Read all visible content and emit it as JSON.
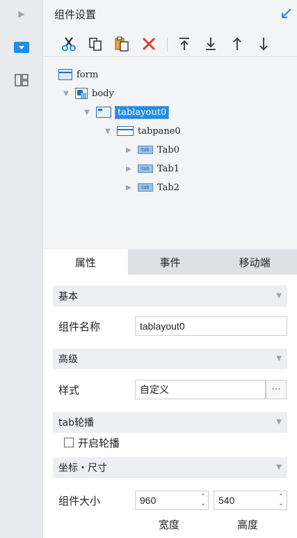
{
  "rail": {
    "icons": [
      "expand-arrow-icon",
      "widget-icon",
      "layout-icon"
    ]
  },
  "header": {
    "title": "组件设置"
  },
  "toolbar": {
    "buttons": [
      "cut-icon",
      "copy-icon",
      "paste-icon",
      "delete-icon",
      "move-top-icon",
      "move-bottom-icon",
      "move-up-icon",
      "move-down-icon"
    ]
  },
  "tree": {
    "nodes": {
      "form": "form",
      "body": "body",
      "tablayout": "tablayout0",
      "tabpane": "tabpane0",
      "tab0": "Tab0",
      "tab1": "Tab1",
      "tab2": "Tab2"
    },
    "small_icon_text": "tab"
  },
  "tabs": {
    "attributes": "属性",
    "events": "事件",
    "mobile": "移动端",
    "active": "属性"
  },
  "props": {
    "basic": {
      "title": "基本",
      "name_label": "组件名称",
      "name_value": "tablayout0"
    },
    "advanced": {
      "title": "高级",
      "style_label": "样式",
      "style_value": "自定义",
      "more": "···"
    },
    "carousel": {
      "title": "tab轮播",
      "enable_label": "开启轮播",
      "enabled": false
    },
    "position_size": {
      "title": "坐标・尺寸",
      "size_label": "组件大小",
      "width": "960",
      "height": "540",
      "width_caption": "宽度",
      "height_caption": "高度"
    }
  },
  "colors": {
    "accent": "#1f8ded",
    "delete": "#e53935",
    "panel_bg": "#f3f4f6"
  }
}
